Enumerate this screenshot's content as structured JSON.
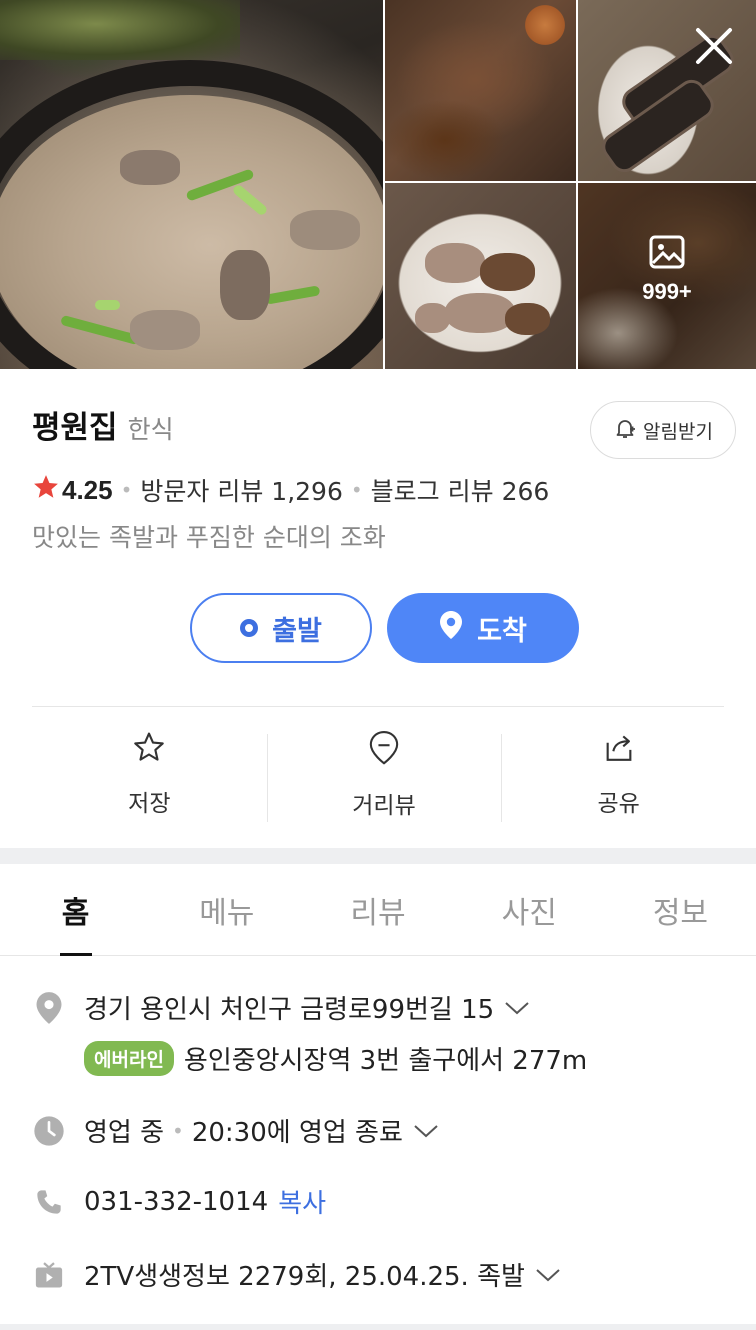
{
  "photos": {
    "more_count": "999+"
  },
  "place": {
    "name": "평원집",
    "category": "한식",
    "rating": "4.25",
    "visitor_reviews_label": "방문자 리뷰 1,296",
    "blog_reviews_label": "블로그 리뷰 266",
    "description": "맛있는 족발과 푸짐한 순대의 조화"
  },
  "notify": {
    "label": "알림받기"
  },
  "route": {
    "start_label": "출발",
    "arrive_label": "도착"
  },
  "actions": {
    "save": "저장",
    "roadview": "거리뷰",
    "share": "공유"
  },
  "tabs": [
    "홈",
    "메뉴",
    "리뷰",
    "사진",
    "정보"
  ],
  "details": {
    "address": "경기 용인시 처인구 금령로99번길 15",
    "line_badge": "에버라인",
    "station_info": "용인중앙시장역 3번 출구에서 277m",
    "status": "영업 중",
    "hours": "20:30에 영업 종료",
    "phone": "031-332-1014",
    "copy_label": "복사",
    "tv": "2TV생생정보 2279회, 25.04.25. 족발"
  },
  "colors": {
    "accent": "#4f86f7",
    "star": "#e8453c",
    "line_badge": "#81b951"
  }
}
